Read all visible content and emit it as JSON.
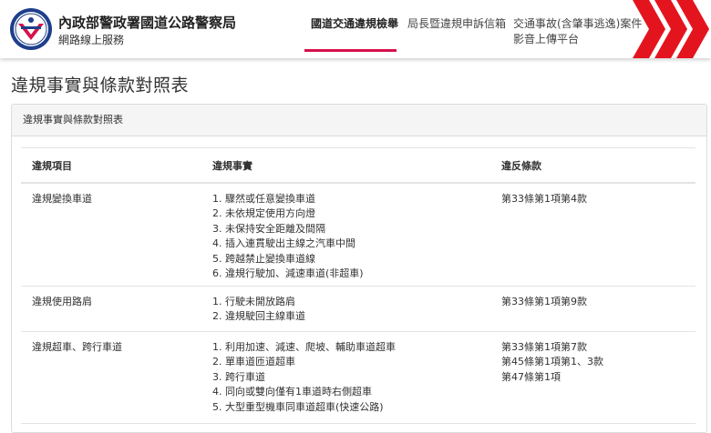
{
  "header": {
    "org_name": "內政部警政署國道公路警察局",
    "org_sub": "網路線上服務",
    "logo_color": "#1e3f8c",
    "accent_color": "#d6114b",
    "nav": [
      {
        "label_lines": [
          "國道交通違規檢舉"
        ],
        "active": true
      },
      {
        "label_lines": [
          "局長暨違規申訴信箱"
        ],
        "active": false
      },
      {
        "label_lines": [
          "交通事故(含肇事逃逸)案件",
          "影音上傳平台"
        ],
        "active": false
      }
    ]
  },
  "page_title": "違規事實與條款對照表",
  "panel": {
    "heading": "違規事實與條款對照表",
    "table": {
      "headers": [
        "違規項目",
        "違規事實",
        "違反條款"
      ],
      "rows": [
        {
          "item": "違規變換車道",
          "facts": [
            "1. 驟然或任意變換車道",
            "2. 未依規定使用方向燈",
            "3. 未保持安全距離及間隔",
            "4. 插入連貫駛出主線之汽車中間",
            "5. 跨越禁止變換車道線",
            "6. 違規行駛加、減速車道(非超車)"
          ],
          "clauses": [
            "第33條第1項第4款"
          ]
        },
        {
          "item": "違規使用路肩",
          "facts": [
            "1. 行駛未開放路肩",
            "2. 違規駛回主線車道"
          ],
          "clauses": [
            "第33條第1項第9款"
          ]
        },
        {
          "item": "違規超車、跨行車道",
          "facts": [
            "1. 利用加速、減速、爬坡、輔助車道超車",
            "2. 單車道匝道超車",
            "3. 跨行車道",
            "4. 同向或雙向僅有1車道時右側超車",
            "5. 大型重型機車同車道超車(快速公路)"
          ],
          "clauses": [
            "第33條第1項第7款",
            "第45條第1項第1、3款",
            "第47條第1項"
          ]
        }
      ]
    }
  }
}
